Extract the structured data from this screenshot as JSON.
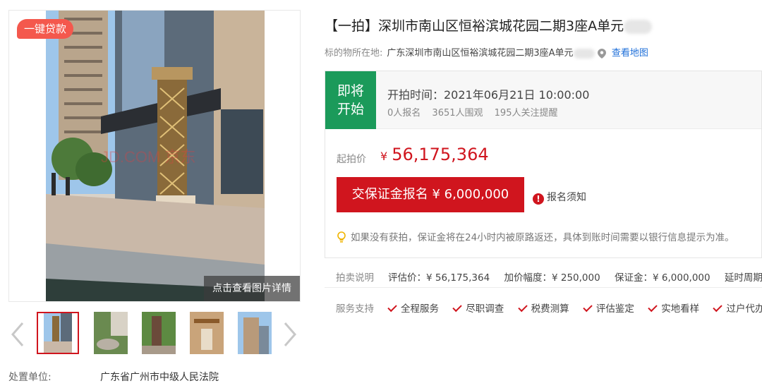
{
  "gallery": {
    "badge": "一键贷款",
    "view_detail": "点击查看图片详情"
  },
  "item": {
    "title": "【一拍】深圳市南山区恒裕滨城花园二期3座A单元",
    "address_label": "标的物所在地:",
    "address_value": "广东深圳市南山区恒裕滨城花园二期3座A单元",
    "map_link": "查看地图"
  },
  "auction": {
    "status": "即将开始",
    "start_time": "开拍时间：2021年06月21日 10:00:00",
    "stats": [
      "0人报名",
      "3651人围观",
      "195人关注提醒"
    ],
    "price_label": "起拍价",
    "currency": "¥",
    "price_value": "56,175,364",
    "apply_button": "交保证金报名 ¥ 6,000,000",
    "notice_link": "报名须知",
    "tip": "如果没有获拍，保证金将在24小时内被原路返还，具体到账时间需要以银行信息提示为准。"
  },
  "description": {
    "label": "拍卖说明",
    "items": [
      "评估价：¥ 56,175,364",
      "加价幅度：¥ 250,000",
      "保证金：¥ 6,000,000",
      "延时周期："
    ]
  },
  "services": {
    "label": "服务支持",
    "items": [
      "全程服务",
      "尽职调查",
      "税费测算",
      "评估鉴定",
      "实地看样",
      "过户代办"
    ]
  },
  "org": {
    "label": "处置单位:",
    "value": "广东省广州市中级人民法院"
  },
  "colors": {
    "accent_red": "#d0151e",
    "status_green": "#1b9a5a",
    "link_blue": "#1e6fd9",
    "badge_red": "#f4584d"
  }
}
